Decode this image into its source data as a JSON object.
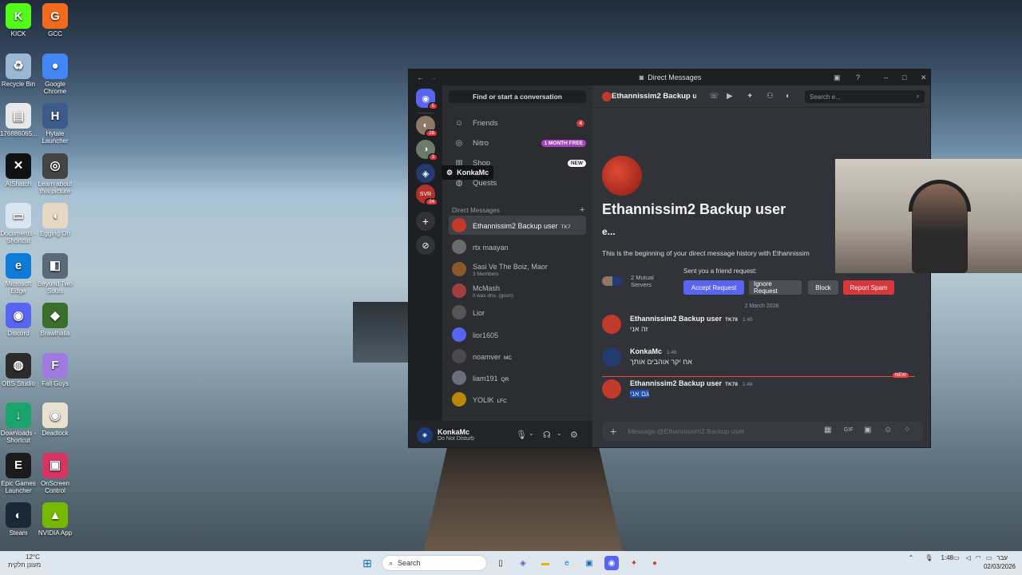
{
  "desktop": {
    "icons": [
      {
        "label": "KICK",
        "color": "#53fc18",
        "glyph": "K"
      },
      {
        "label": "GCC",
        "color": "#f26b1d",
        "glyph": "G"
      },
      {
        "label": "Recycle Bin",
        "color": "#9bb7d4",
        "glyph": "♻"
      },
      {
        "label": "Google Chrome",
        "color": "#4285f4",
        "glyph": "●"
      },
      {
        "label": "176886065...",
        "color": "#e8e8e8",
        "glyph": "▤"
      },
      {
        "label": "Hytale Launcher",
        "color": "#3c5a8a",
        "glyph": "H"
      },
      {
        "label": "AIShatch",
        "color": "#111111",
        "glyph": "✕"
      },
      {
        "label": "Learn about this picture",
        "color": "#444444",
        "glyph": "◎"
      },
      {
        "label": "Documents - Shortcut",
        "color": "#d9e6f2",
        "glyph": "▭"
      },
      {
        "label": "Egging On",
        "color": "#e6d8c2",
        "glyph": "◖"
      },
      {
        "label": "Microsoft Edge",
        "color": "#0f7bd8",
        "glyph": "e"
      },
      {
        "label": "Beyond Two Souls",
        "color": "#5a6a7a",
        "glyph": "◧"
      },
      {
        "label": "Discord",
        "color": "#5865f2",
        "glyph": "◉"
      },
      {
        "label": "Brawlhalla",
        "color": "#3b6e2a",
        "glyph": "◆"
      },
      {
        "label": "OBS Studio",
        "color": "#2b2b2b",
        "glyph": "◍"
      },
      {
        "label": "Fall Guys",
        "color": "#9f7be0",
        "glyph": "F"
      },
      {
        "label": "Downloads - Shortcut",
        "color": "#1aa36b",
        "glyph": "↓"
      },
      {
        "label": "Deadlock",
        "color": "#e8e1d0",
        "glyph": "◉"
      },
      {
        "label": "Epic Games Launcher",
        "color": "#1b1b1b",
        "glyph": "E"
      },
      {
        "label": "OnScreen Control",
        "color": "#d6355f",
        "glyph": "▣"
      },
      {
        "label": "Steam",
        "color": "#1b2838",
        "glyph": "◐"
      },
      {
        "label": "NVIDIA App",
        "color": "#76b900",
        "glyph": "▲"
      }
    ]
  },
  "taskbar": {
    "weather_temp": "12°C",
    "weather_text": "מעונן חלקית",
    "search_label": "Search",
    "lang": "עבר",
    "time": "1:48",
    "date": "02/03/2026"
  },
  "discord": {
    "window_title": "Direct Messages",
    "guild_badges": [
      "5",
      "28",
      "3",
      "24"
    ],
    "tooltip": "KonkaMc",
    "find_label": "Find or start a conversation",
    "nav": [
      {
        "label": "Friends",
        "badge": "4",
        "icon": "friends-icon"
      },
      {
        "label": "Nitro",
        "badge": "1 MONTH FREE",
        "icon": "nitro-icon"
      },
      {
        "label": "Shop",
        "badge": "NEW",
        "icon": "shop-icon"
      },
      {
        "label": "Quests",
        "badge": "",
        "icon": "quests-icon"
      }
    ],
    "dm_header": "Direct Messages",
    "dms": [
      {
        "name": "Ethannissim2 Backup user",
        "tag": "TK7",
        "sub": "",
        "color": "#c0392b"
      },
      {
        "name": "rtx maayan",
        "tag": "",
        "sub": "",
        "color": "#6b6b6b"
      },
      {
        "name": "Sasi Ve The Boiz, Maor",
        "tag": "",
        "sub": "3 Members",
        "color": "#8a5a2b"
      },
      {
        "name": "McMash",
        "tag": "",
        "sub": "it was dns. (gosh)",
        "color": "#a04040"
      },
      {
        "name": "Lior",
        "tag": "",
        "sub": "",
        "color": "#555555"
      },
      {
        "name": "lior1605",
        "tag": "",
        "sub": "",
        "color": "#5865f2"
      },
      {
        "name": "noamver",
        "tag": "MC",
        "sub": "",
        "color": "#4a4a4a"
      },
      {
        "name": "liam191",
        "tag": "QR",
        "sub": "",
        "color": "#6d6f78"
      },
      {
        "name": "YOLIK",
        "tag": "LFC",
        "sub": "",
        "color": "#b8860b"
      }
    ],
    "user": {
      "name": "KonkaMc",
      "status": "Do Not Disturb"
    },
    "chat": {
      "header_title": "Ethannissim2 Backup u",
      "search_placeholder": "Search e...",
      "big_name": "Ethannissim2 Backup user",
      "big_sub": "e...",
      "beginning": "This is the beginning of your direct message history with Ethannissim",
      "mutual": "2 Mutual Servers",
      "friend_req_label": "Sent you a friend request:",
      "buttons": {
        "accept": "Accept Request",
        "ignore": "Ignore Request",
        "block": "Block",
        "spam": "Report Spam"
      },
      "date_divider": "2 March 2026",
      "messages": [
        {
          "author": "Ethannissim2 Backup user",
          "tag": "TK78",
          "time": "1:45",
          "text": "זה אני"
        },
        {
          "author": "KonkaMc",
          "tag": "",
          "time": "1:46",
          "text": "אח יקר אוהבים אותך"
        },
        {
          "author": "Ethannissim2 Backup user",
          "tag": "TK78",
          "time": "1:46",
          "text": "גם אני"
        }
      ],
      "new_label": "NEW",
      "composer_placeholder": "Message @Ethannissim2 Backup user"
    },
    "colors": {
      "blurple": "#5865f2",
      "red": "#da373c",
      "nitro": "#a644c0"
    }
  }
}
